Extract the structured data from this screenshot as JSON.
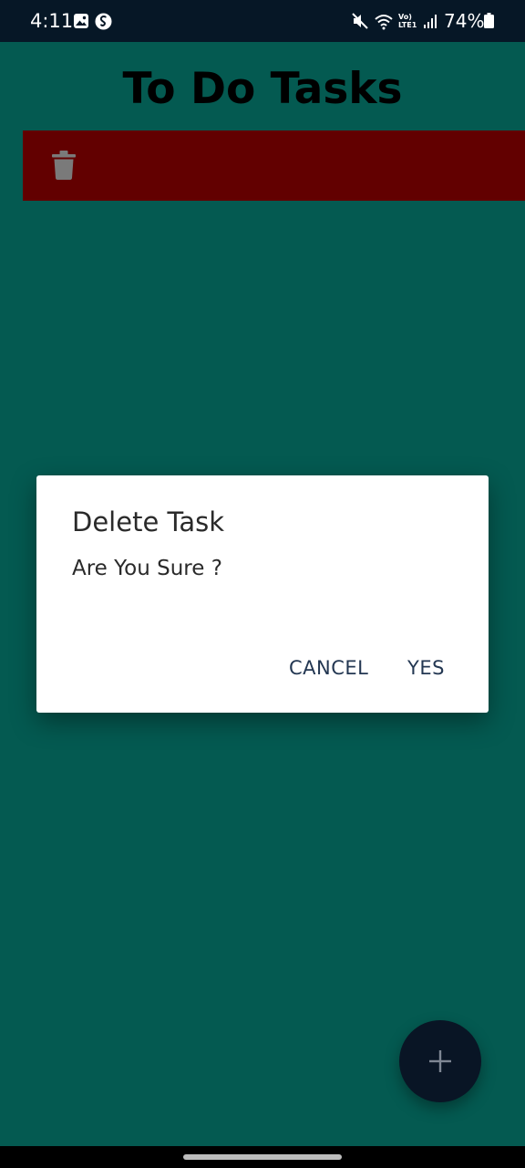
{
  "status_bar": {
    "time": "4:11",
    "battery": "74%",
    "network_label": "Vo) LTE1",
    "icons": [
      "gallery-icon",
      "shazam-icon",
      "mute-icon",
      "wifi-icon",
      "signal-icon",
      "battery-icon"
    ]
  },
  "app": {
    "title": "To Do Tasks"
  },
  "task_row": {
    "swipe_action_icon": "trash-icon",
    "background": "#620000"
  },
  "dialog": {
    "title": "Delete Task",
    "message": "Are You Sure ?",
    "cancel_label": "CANCEL",
    "confirm_label": "YES"
  },
  "fab": {
    "icon": "plus-icon"
  },
  "colors": {
    "background": "#045a51",
    "status_bar": "#061726",
    "dialog_button": "#233752",
    "fab": "#091525"
  }
}
